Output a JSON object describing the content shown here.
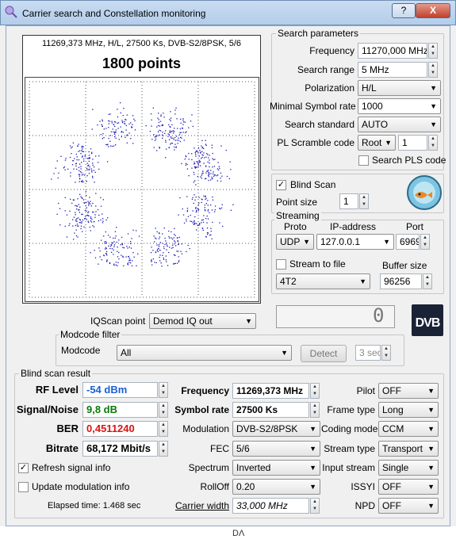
{
  "window": {
    "title": "Carrier search and Constellation monitoring",
    "help_glyph": "?",
    "close_glyph": "X"
  },
  "background_strip_text": "DΛ",
  "constellation": {
    "header": "11269,373 MHz, H/L, 27500 Ks, DVB-S2/8PSK, 5/6",
    "points_label": "1800 points",
    "dot_color": "#1a1ab4"
  },
  "search_parameters": {
    "title": "Search parameters",
    "frequency": {
      "label": "Frequency",
      "value": "11270,000 MHz"
    },
    "search_range": {
      "label": "Search range",
      "value": "5 MHz"
    },
    "polarization": {
      "label": "Polarization",
      "value": "H/L"
    },
    "min_symbol_rate": {
      "label": "Minimal Symbol rate",
      "value": "1000"
    },
    "search_standard": {
      "label": "Search standard",
      "value": "AUTO"
    },
    "pl_scramble": {
      "label": "PL Scramble code",
      "mode": "Root",
      "value": "1"
    },
    "search_pls": {
      "label": "Search PLS code",
      "checked": false
    }
  },
  "blind_scan": {
    "label": "Blind Scan",
    "checked": true
  },
  "point_size": {
    "label": "Point size",
    "value": "1"
  },
  "streaming": {
    "title": "Streaming",
    "proto_header": "Proto",
    "ip_header": "IP-address",
    "port_header": "Port",
    "proto": "UDP",
    "ip": "127.0.0.1",
    "port": "6969",
    "stream_to_file": {
      "label": "Stream to file",
      "checked": false
    },
    "buffer_size_label": "Buffer size",
    "file_format": "4T2",
    "buffer_size": "96256"
  },
  "iq_scan": {
    "label": "IQScan point",
    "value": "Demod IQ out"
  },
  "lcd_value": "0",
  "logo_text": "DVB",
  "modcode_filter": {
    "title": "Modcode filter",
    "label": "Modcode",
    "value": "All",
    "detect_label": "Detect",
    "interval": "3 sec"
  },
  "result": {
    "title": "Blind scan result",
    "rf_level": {
      "label": "RF Level",
      "value": "-54 dBm",
      "color": "#1a5fd8"
    },
    "snr": {
      "label": "Signal/Noise",
      "value": "9,8 dB",
      "color": "#0a7a0a"
    },
    "ber": {
      "label": "BER",
      "value": "0,4511240",
      "color": "#d81414"
    },
    "bitrate": {
      "label": "Bitrate",
      "value": "68,172 Mbit/s"
    },
    "refresh_signal": {
      "label": "Refresh signal info",
      "checked": true
    },
    "update_modulation": {
      "label": "Update modulation info",
      "checked": false
    },
    "elapsed": "Elapsed time: 1.468 sec",
    "frequency": {
      "label": "Frequency",
      "value": "11269,373 MHz"
    },
    "symbol_rate": {
      "label": "Symbol rate",
      "value": "27500 Ks"
    },
    "modulation": {
      "label": "Modulation",
      "value": "DVB-S2/8PSK"
    },
    "fec": {
      "label": "FEC",
      "value": "5/6"
    },
    "spectrum": {
      "label": "Spectrum",
      "value": "Inverted"
    },
    "rolloff": {
      "label": "RollOff",
      "value": "0.20"
    },
    "carrier_width": {
      "label": "Carrier width",
      "value": "33,000 MHz"
    },
    "pilot": {
      "label": "Pilot",
      "value": "OFF"
    },
    "frame_type": {
      "label": "Frame type",
      "value": "Long"
    },
    "coding_mode": {
      "label": "Coding mode",
      "value": "CCM"
    },
    "stream_type": {
      "label": "Stream type",
      "value": "Transport"
    },
    "input_stream": {
      "label": "Input stream",
      "value": "Single"
    },
    "issyi": {
      "label": "ISSYI",
      "value": "OFF"
    },
    "npd": {
      "label": "NPD",
      "value": "OFF"
    }
  }
}
